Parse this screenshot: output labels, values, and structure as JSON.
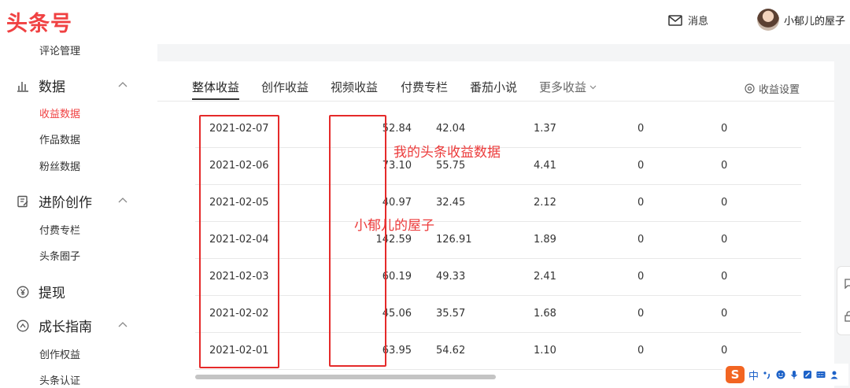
{
  "header": {
    "logo": "头条号",
    "messages_label": "消息",
    "user_name": "小郁儿的屋子"
  },
  "sidebar": {
    "top_cut_item": "评论管理",
    "groups": [
      {
        "label": "数据",
        "items": [
          "收益数据",
          "作品数据",
          "粉丝数据"
        ]
      },
      {
        "label": "进阶创作",
        "items": [
          "付费专栏",
          "头条圈子"
        ]
      },
      {
        "label": "提现",
        "items": []
      },
      {
        "label": "成长指南",
        "items": [
          "创作权益",
          "头条认证"
        ]
      }
    ]
  },
  "tabs": [
    "整体收益",
    "创作收益",
    "视频收益",
    "付费专栏",
    "番茄小说",
    "更多收益"
  ],
  "settings_label": "收益设置",
  "table": {
    "rows": [
      [
        "2021-02-07",
        "52.84",
        "42.04",
        "1.37",
        "0",
        "0"
      ],
      [
        "2021-02-06",
        "73.10",
        "55.75",
        "4.41",
        "0",
        "0"
      ],
      [
        "2021-02-05",
        "40.97",
        "32.45",
        "2.12",
        "0",
        "0"
      ],
      [
        "2021-02-04",
        "142.59",
        "126.91",
        "1.89",
        "0",
        "0"
      ],
      [
        "2021-02-03",
        "60.19",
        "49.33",
        "2.41",
        "0",
        "0"
      ],
      [
        "2021-02-02",
        "45.06",
        "35.57",
        "1.68",
        "0",
        "0"
      ],
      [
        "2021-02-01",
        "63.95",
        "54.62",
        "1.10",
        "0",
        "0"
      ]
    ]
  },
  "annotations": {
    "a1": "我的头条收益数据",
    "a2": "小郁儿的屋子"
  },
  "ime": {
    "logo": "S",
    "lang": "中"
  },
  "colors": {
    "brand": "#f04142",
    "annotation": "#e52a2a"
  }
}
